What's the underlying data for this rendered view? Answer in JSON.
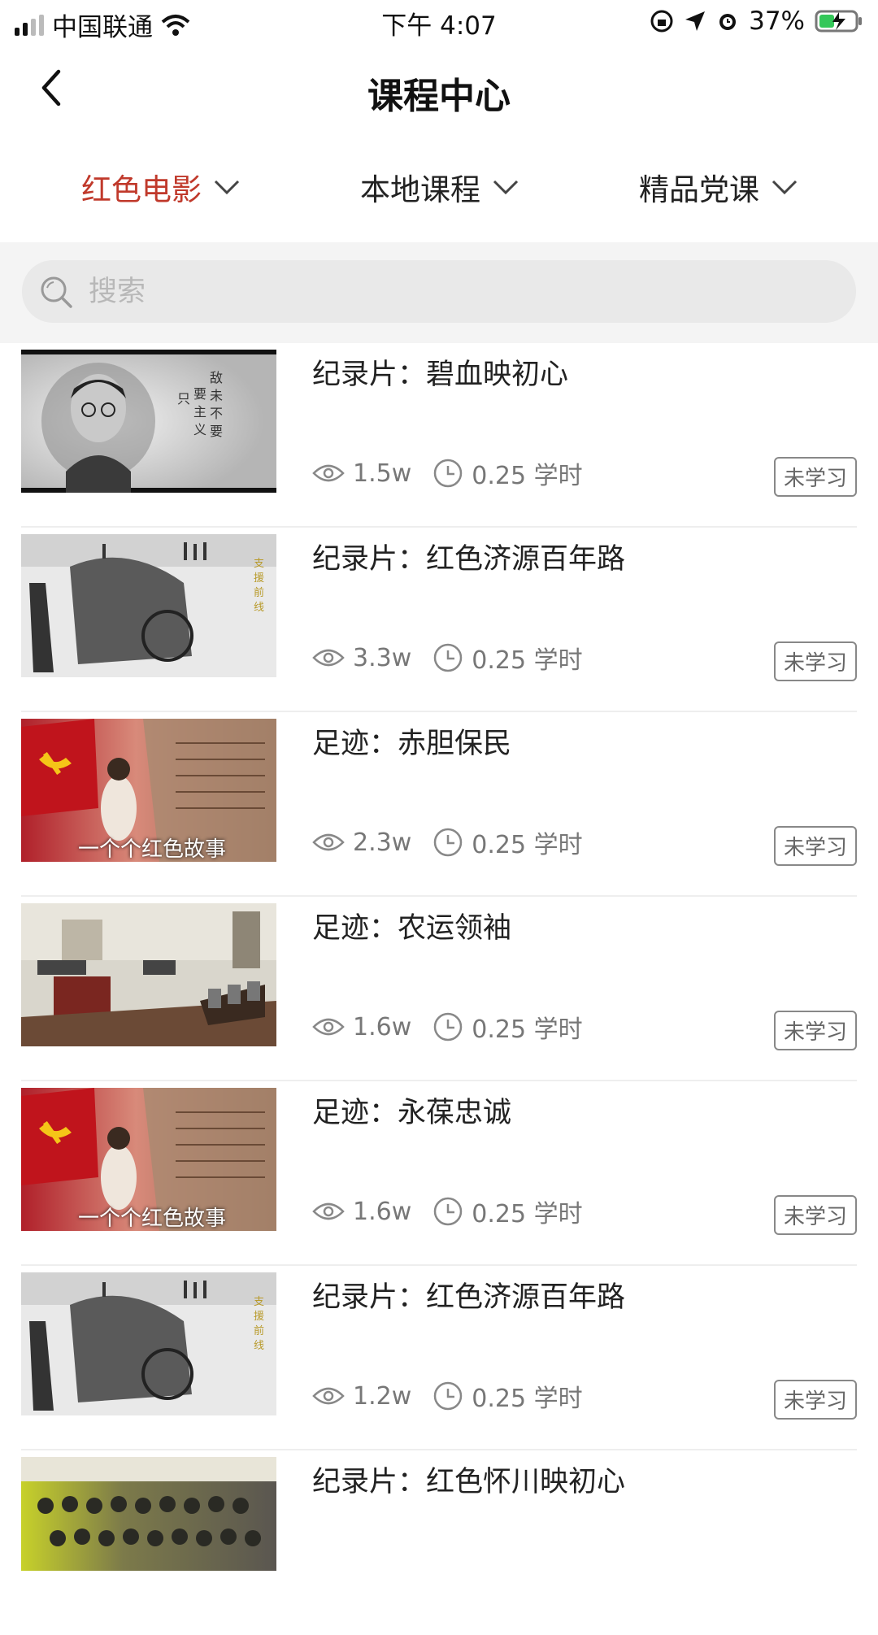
{
  "status_bar": {
    "carrier": "中国联通",
    "time": "下午 4:07",
    "battery": "37%"
  },
  "nav": {
    "title": "课程中心"
  },
  "filters": [
    {
      "label": "红色电影",
      "active": true
    },
    {
      "label": "本地课程",
      "active": false
    },
    {
      "label": "精品党课",
      "active": false
    }
  ],
  "search": {
    "placeholder": "搜索"
  },
  "courses": [
    {
      "title": "纪录片：碧血映初心",
      "views": "1.5w",
      "hours": "0.25 学时",
      "status": "未学习",
      "thumb": "portrait-calligraphy"
    },
    {
      "title": "纪录片：红色济源百年路",
      "views": "3.3w",
      "hours": "0.25 学时",
      "status": "未学习",
      "thumb": "bw-cart-scene"
    },
    {
      "title": "足迹：赤胆保民",
      "views": "2.3w",
      "hours": "0.25 学时",
      "status": "未学习",
      "thumb": "red-flag-story"
    },
    {
      "title": "足迹：农运领袖",
      "views": "1.6w",
      "hours": "0.25 学时",
      "status": "未学习",
      "thumb": "memorial-hall"
    },
    {
      "title": "足迹：永葆忠诚",
      "views": "1.6w",
      "hours": "0.25 学时",
      "status": "未学习",
      "thumb": "red-flag-story"
    },
    {
      "title": "纪录片：红色济源百年路",
      "views": "1.2w",
      "hours": "0.25 学时",
      "status": "未学习",
      "thumb": "bw-cart-scene"
    },
    {
      "title": "纪录片：红色怀川映初心",
      "views": "",
      "hours": "",
      "status": "",
      "thumb": "group-photo"
    }
  ],
  "thumb_overlay_text": "一个个红色故事",
  "colors": {
    "accent": "#c0392b",
    "meta_gray": "#777777"
  }
}
